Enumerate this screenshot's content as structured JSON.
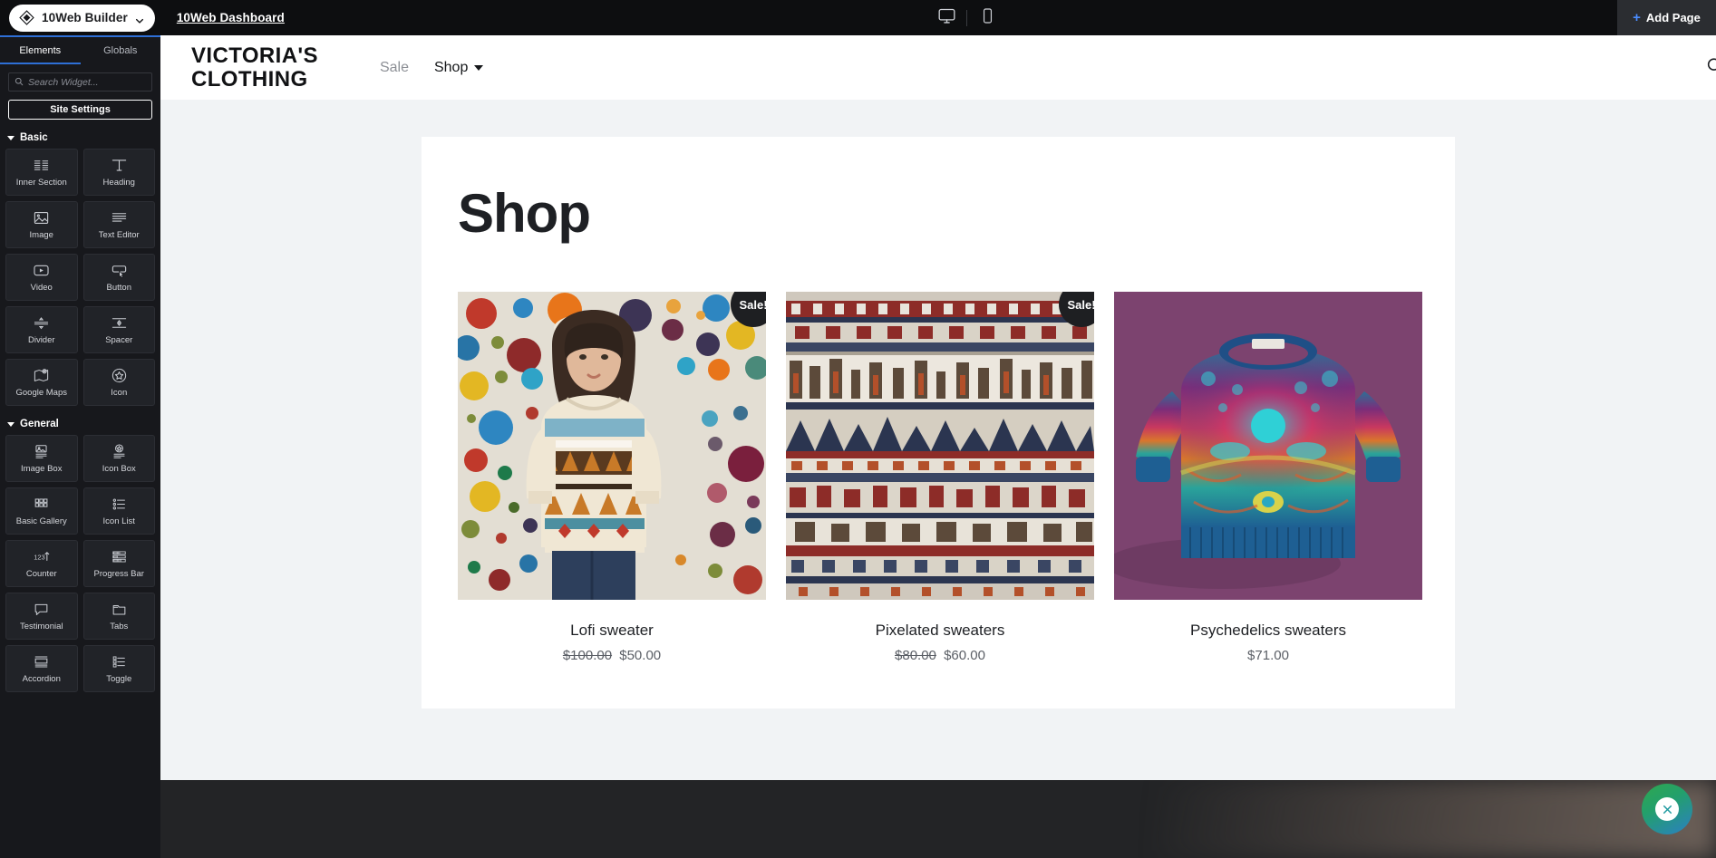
{
  "topbar": {
    "builder_label": "10Web Builder",
    "builder_logo_icon": "diamond-logo-icon",
    "builder_chevron_icon": "chevron-down-icon",
    "dashboard_link": "10Web Dashboard",
    "desktop_icon": "desktop-monitor-icon",
    "mobile_icon": "mobile-phone-icon",
    "add_page_plus": "+",
    "add_page_label": "Add Page",
    "accent_color": "#4a8cff"
  },
  "sidebar": {
    "tabs": [
      {
        "label": "Elements",
        "active": true
      },
      {
        "label": "Globals",
        "active": false
      }
    ],
    "search": {
      "placeholder": "Search Widget...",
      "value": "",
      "icon": "search-icon"
    },
    "site_settings_label": "Site Settings",
    "groups": [
      {
        "title": "Basic",
        "widgets": [
          {
            "label": "Inner Section",
            "icon": "inner-section-icon"
          },
          {
            "label": "Heading",
            "icon": "heading-t-icon"
          },
          {
            "label": "Image",
            "icon": "image-icon"
          },
          {
            "label": "Text Editor",
            "icon": "text-lines-icon"
          },
          {
            "label": "Video",
            "icon": "video-play-icon"
          },
          {
            "label": "Button",
            "icon": "button-cursor-icon"
          },
          {
            "label": "Divider",
            "icon": "divider-icon"
          },
          {
            "label": "Spacer",
            "icon": "spacer-icon"
          },
          {
            "label": "Google Maps",
            "icon": "map-pin-icon"
          },
          {
            "label": "Icon",
            "icon": "star-circle-icon"
          }
        ]
      },
      {
        "title": "General",
        "widgets": [
          {
            "label": "Image Box",
            "icon": "image-box-icon"
          },
          {
            "label": "Icon Box",
            "icon": "icon-box-icon"
          },
          {
            "label": "Basic Gallery",
            "icon": "gallery-grid-icon"
          },
          {
            "label": "Icon List",
            "icon": "icon-list-icon"
          },
          {
            "label": "Counter",
            "icon": "counter-123-icon"
          },
          {
            "label": "Progress Bar",
            "icon": "progress-bar-icon"
          },
          {
            "label": "Testimonial",
            "icon": "speech-bubble-icon"
          },
          {
            "label": "Tabs",
            "icon": "tabs-folder-icon"
          },
          {
            "label": "Accordion",
            "icon": "accordion-icon"
          },
          {
            "label": "Toggle",
            "icon": "toggle-list-icon"
          }
        ]
      }
    ]
  },
  "site": {
    "brand_line1": "VICTORIA'S",
    "brand_line2": "CLOTHING",
    "nav": [
      {
        "label": "Sale",
        "active": false,
        "has_dropdown": false
      },
      {
        "label": "Shop",
        "active": true,
        "has_dropdown": true
      }
    ],
    "search_icon": "search-icon",
    "page_title": "Shop",
    "products": [
      {
        "name": "Lofi sweater",
        "old_price": "$100.00",
        "price": "$50.00",
        "on_sale": true,
        "sale_label": "Sale!",
        "image_alt": "woman-in-patterned-sweater-with-colorful-dots-backdrop"
      },
      {
        "name": "Pixelated sweaters",
        "old_price": "$80.00",
        "price": "$60.00",
        "on_sale": true,
        "sale_label": "Sale!",
        "image_alt": "pixelated-fair-isle-knit-pattern"
      },
      {
        "name": "Psychedelics sweaters",
        "old_price": "",
        "price": "$71.00",
        "on_sale": false,
        "sale_label": "",
        "image_alt": "psychedelic-knit-sweater-on-purple-background"
      }
    ]
  },
  "fab": {
    "icon": "close-x-icon",
    "gradient_from": "#2fa84f",
    "gradient_to": "#2b7fc4"
  }
}
